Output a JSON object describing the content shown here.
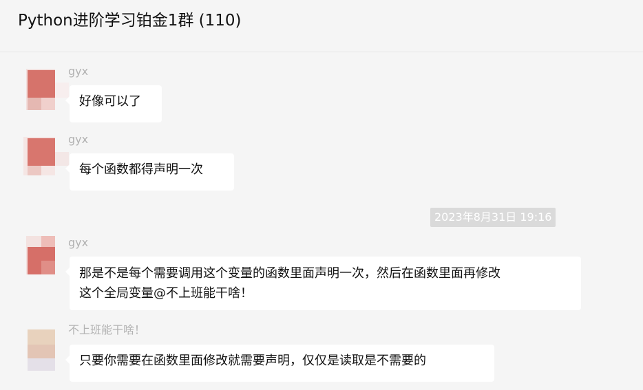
{
  "window": {
    "title": "Python进阶学习铂金1群 (110)"
  },
  "colors": {
    "background": "#f5f5f5",
    "bubble": "#ffffff",
    "sender_name": "#b2b2b2",
    "timestamp_bg": "#dadada"
  },
  "messages": [
    {
      "sender": "gyx",
      "lines": [
        "好像可以了"
      ]
    },
    {
      "sender": "gyx",
      "lines": [
        "每个函数都得声明一次"
      ]
    },
    {
      "sender": "gyx",
      "lines": [
        "那是不是每个需要调用这个变量的函数里面声明一次，然后在函数里面再修改",
        "这个全局变量@不上班能干啥！"
      ]
    },
    {
      "sender": "不上班能干啥！",
      "lines": [
        "只要你需要在函数里面修改就需要声明，仅仅是读取是不需要的"
      ]
    }
  ],
  "timestamp": "2023年8月31日 19:16"
}
